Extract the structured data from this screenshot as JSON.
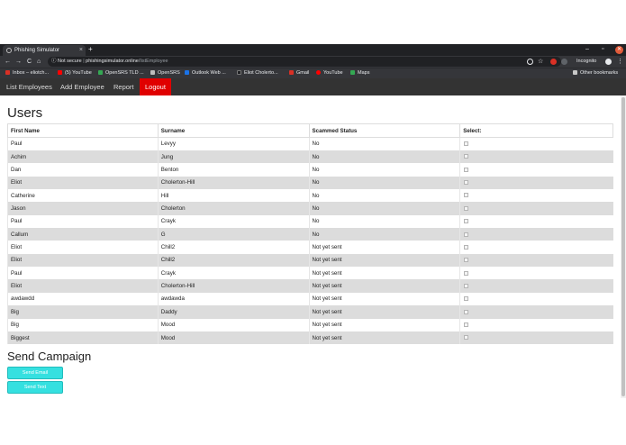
{
  "browser": {
    "tab_title": "Phishing Simulator",
    "tab_close": "×",
    "new_tab": "+",
    "window_controls": {
      "minimize": "–",
      "restore": "▫",
      "close": "✕"
    },
    "nav": {
      "back": "←",
      "forward": "→",
      "reload": "C",
      "home": "⌂",
      "info": "ⓘ"
    },
    "security_label": "Not secure",
    "url_host": "phishingsimulator.online",
    "url_path": "/listEmployee",
    "incognito_label": "Incognito",
    "bookmarks": [
      {
        "label": "Inbox – eliotch...",
        "color": "#d93025"
      },
      {
        "label": "(5) YouTube",
        "color": "#ff0000"
      },
      {
        "label": "OpenSRS TLD ...",
        "color": "#34a853"
      },
      {
        "label": "OpenSRS",
        "color": "#bdbdbd"
      },
      {
        "label": "Outlook Web ...",
        "color": "#1a73e8"
      },
      {
        "label": "Eliot Cholerto...",
        "color": "#202124"
      },
      {
        "label": "Gmail",
        "color": "#d93025"
      },
      {
        "label": "YouTube",
        "color": "#ff0000"
      },
      {
        "label": "Maps",
        "color": "#34a853"
      }
    ],
    "other_bookmarks": "Other bookmarks"
  },
  "navbar": {
    "items": [
      "List Employees",
      "Add Employee",
      "Report"
    ],
    "logout": "Logout"
  },
  "page_title": "Users",
  "table": {
    "headers": [
      "First Name",
      "Surname",
      "Scammed Status",
      "Select:"
    ],
    "rows": [
      [
        "Paul",
        "Levyy",
        "No"
      ],
      [
        "Achim",
        "Jung",
        "No"
      ],
      [
        "Dan",
        "Benton",
        "No"
      ],
      [
        "Eliot",
        "Cholerton-Hill",
        "No"
      ],
      [
        "Catherine",
        "Hill",
        "No"
      ],
      [
        "Jason",
        "Cholerton",
        "No"
      ],
      [
        "Paul",
        "Crayk",
        "No"
      ],
      [
        "Callum",
        "G",
        "No"
      ],
      [
        "Eliot",
        "Chill2",
        "Not yet sent"
      ],
      [
        "Eliot",
        "Chill2",
        "Not yet sent"
      ],
      [
        "Paul",
        "Crayk",
        "Not yet sent"
      ],
      [
        "Eliot",
        "Cholerton-Hill",
        "Not yet sent"
      ],
      [
        "awdawdd",
        "awdawda",
        "Not yet sent"
      ],
      [
        "Big",
        "Daddy",
        "Not yet sent"
      ],
      [
        "Big",
        "Mood",
        "Not yet sent"
      ],
      [
        "Biggest",
        "Mood",
        "Not yet sent"
      ]
    ]
  },
  "campaign": {
    "title": "Send Campaign",
    "send_email": "Send Email",
    "send_text": "Send Text"
  },
  "colors": {
    "accent_logout": "#e00000",
    "button": "#35e0e0",
    "navbar": "#333333"
  }
}
